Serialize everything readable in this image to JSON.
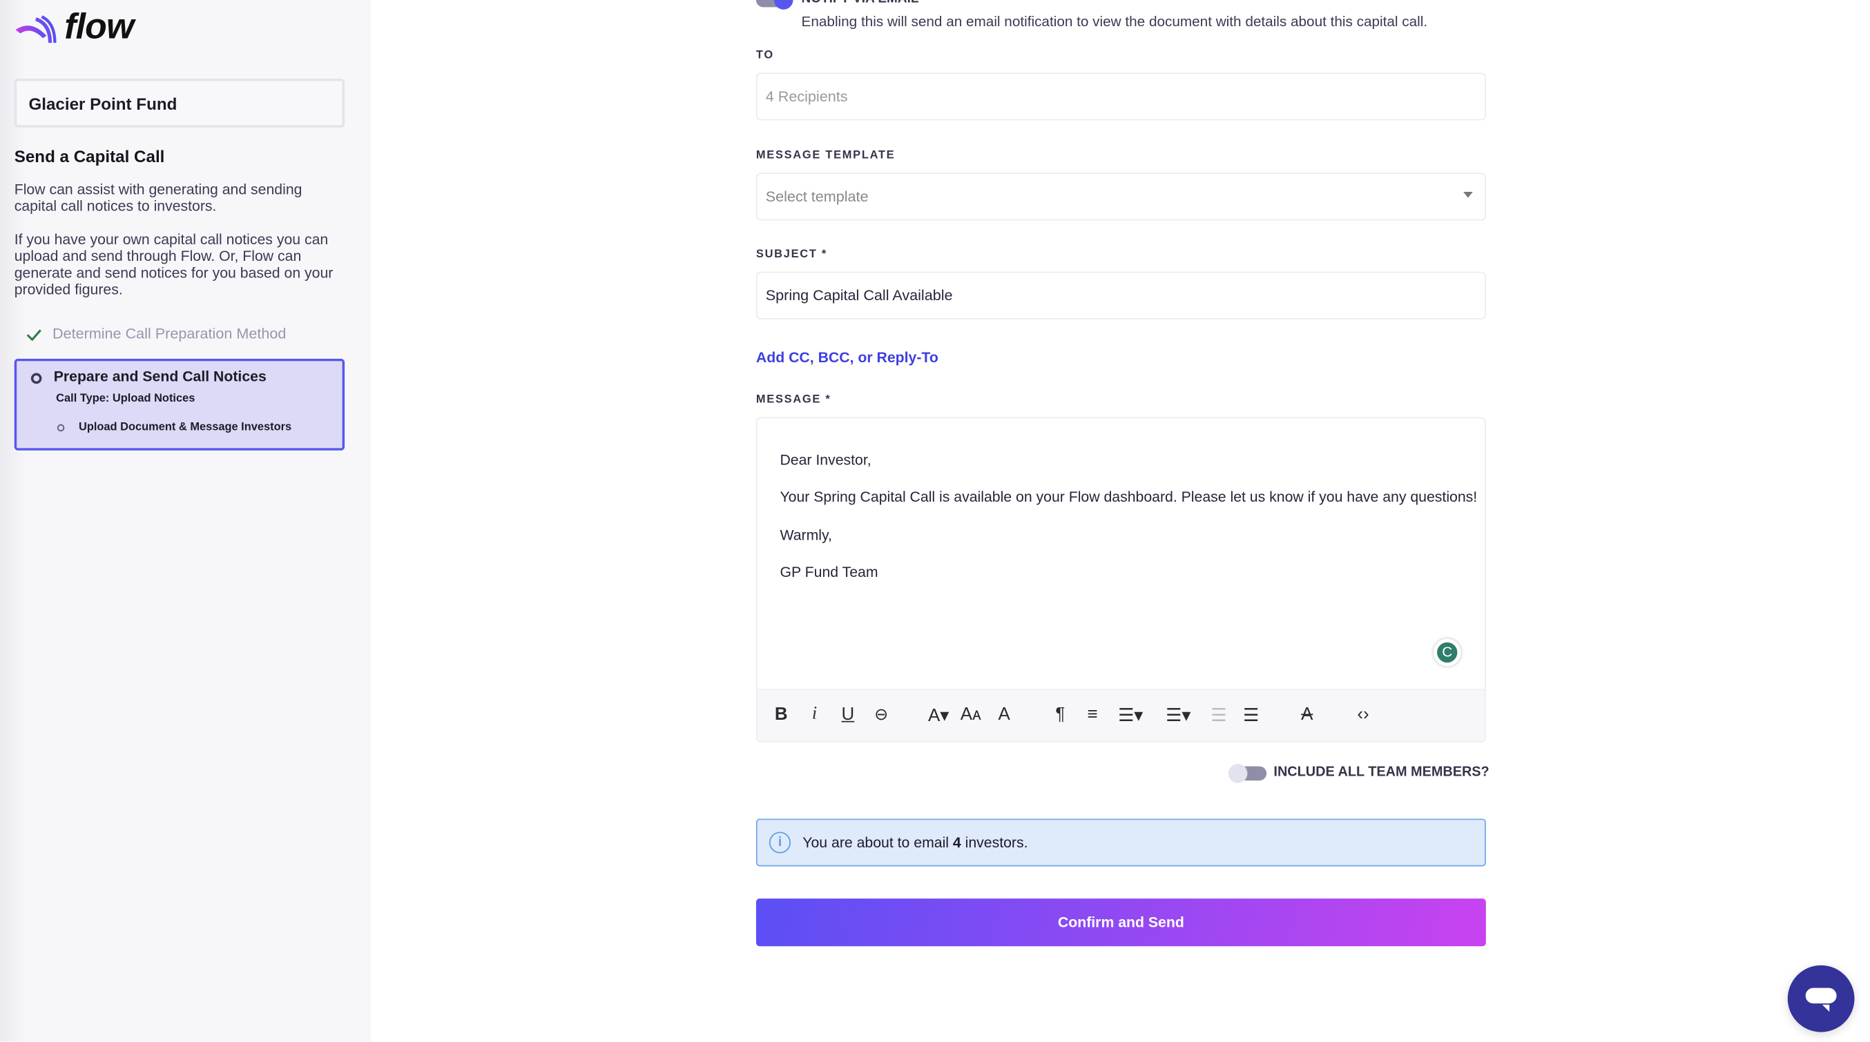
{
  "sidebar": {
    "logo_text": "flow",
    "fund_name": "Glacier Point Fund",
    "title": "Send a Capital Call",
    "intro": "Flow can assist with generating and sending capital call notices to investors.",
    "details": "If you have your own capital call notices you can upload and send through Flow. Or, Flow can generate and send notices for you based on your provided figures.",
    "steps": [
      {
        "label": "Determine Call Preparation Method",
        "status": "complete"
      },
      {
        "label": "Prepare and Send Call Notices",
        "status": "active",
        "subtitle": "Call Type: Upload Notices",
        "substeps": [
          {
            "label": "Upload Document & Message Investors"
          }
        ]
      }
    ]
  },
  "form": {
    "notify": {
      "label": "NOTIFY VIA EMAIL",
      "enabled": true,
      "description": "Enabling this will send an email notification to view the document with details about this capital call."
    },
    "to": {
      "label": "TO",
      "placeholder": "4 Recipients"
    },
    "template": {
      "label": "MESSAGE TEMPLATE",
      "placeholder": "Select template"
    },
    "subject": {
      "label": "SUBJECT *",
      "value": "Spring Capital Call Available"
    },
    "cc_link": "Add CC, BCC, or Reply-To",
    "message": {
      "label": "MESSAGE *",
      "lines": [
        "Dear Investor,",
        "Your Spring Capital Call is available on your Flow dashboard. Please let us know if you have any questions!",
        "Warmly,",
        "GP Fund Team"
      ]
    },
    "toolbar": [
      "bold-icon",
      "italic-icon",
      "underline-icon",
      "link-icon",
      "font-size-icon",
      "font-family-icon",
      "text-color-icon",
      "paragraph-format-icon",
      "align-icon",
      "ordered-list-icon",
      "unordered-list-icon",
      "outdent-icon",
      "indent-icon",
      "clear-format-icon",
      "code-view-icon"
    ],
    "include_team": {
      "label": "INCLUDE ALL TEAM MEMBERS?",
      "enabled": false
    },
    "info": {
      "prefix": "You are about to email ",
      "count": "4",
      "suffix": " investors."
    },
    "submit": "Confirm and Send"
  },
  "colors": {
    "accent": "#5757ee",
    "button_start": "#5b4ff5",
    "button_end": "#c843f0",
    "info_bg": "#dfeafb",
    "chat": "#33339a"
  }
}
